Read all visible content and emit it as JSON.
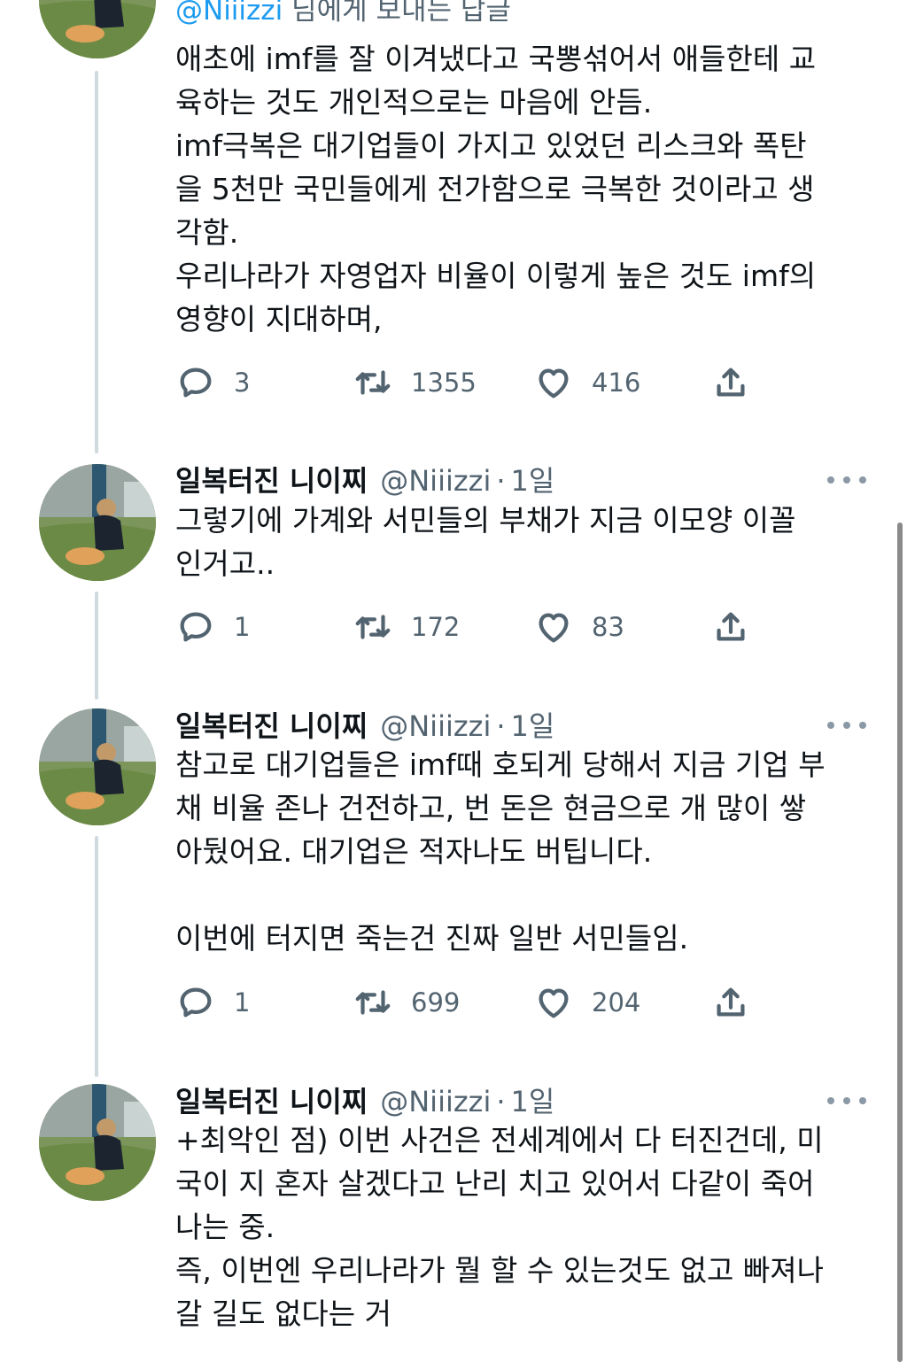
{
  "thread": {
    "top_tweet": {
      "reply_to_handle": "@Niiizzi",
      "reply_to_suffix": "님에게 보내는 답글",
      "paragraphs": [
        "애초에 imf를 잘 이겨냈다고 국뽕섞어서 애들한테 교\n육하는 것도 개인적으로는 마음에 안듬.",
        "imf극복은 대기업들이 가지고 있었던 리스크와 폭탄\n을 5천만 국민들에게 전가함으로 극복한 것이라고 생\n각함.",
        "우리나라가 자영업자 비율이 이렇게 높은 것도 imf의\n영향이 지대하며,"
      ],
      "replies": "3",
      "retweets": "1355",
      "likes": "416"
    },
    "tweets": [
      {
        "name": "일복터진 니이찌",
        "handle": "@Niiizzi",
        "separator": "·",
        "time": "1일",
        "paragraphs": [
          "그렇기에 가계와 서민들의 부채가 지금 이모양 이꼴\n인거고.."
        ],
        "replies": "1",
        "retweets": "172",
        "likes": "83"
      },
      {
        "name": "일복터진 니이찌",
        "handle": "@Niiizzi",
        "separator": "·",
        "time": "1일",
        "paragraphs": [
          "참고로 대기업들은 imf때 호되게 당해서 지금 기업 부\n채 비율 존나 건전하고, 번 돈은 현금으로 개 많이 쌓\n아뒀어요. 대기업은 적자나도 버팁니다.",
          "이번에 터지면 죽는건 진짜 일반 서민들임."
        ],
        "replies": "1",
        "retweets": "699",
        "likes": "204"
      },
      {
        "name": "일복터진 니이찌",
        "handle": "@Niiizzi",
        "separator": "·",
        "time": "1일",
        "paragraphs": [
          "+최악인 점) 이번 사건은 전세계에서 다 터진건데, 미\n국이 지 혼자 살겠다고 난리 치고 있어서 다같이 죽어\n나는 중.",
          "즉, 이번엔 우리나라가 뭘 할 수 있는것도 없고 빠져나\n갈 길도 없다는 거"
        ]
      }
    ]
  },
  "icons": {
    "reply": "speech-bubble-icon",
    "retweet": "retweet-arrows-icon",
    "like": "heart-icon",
    "share": "share-upload-icon",
    "more": "more-dots-icon"
  },
  "colors": {
    "link": "#1d9bf0",
    "secondary_text": "#536471",
    "thread_line": "#cfd9de"
  }
}
